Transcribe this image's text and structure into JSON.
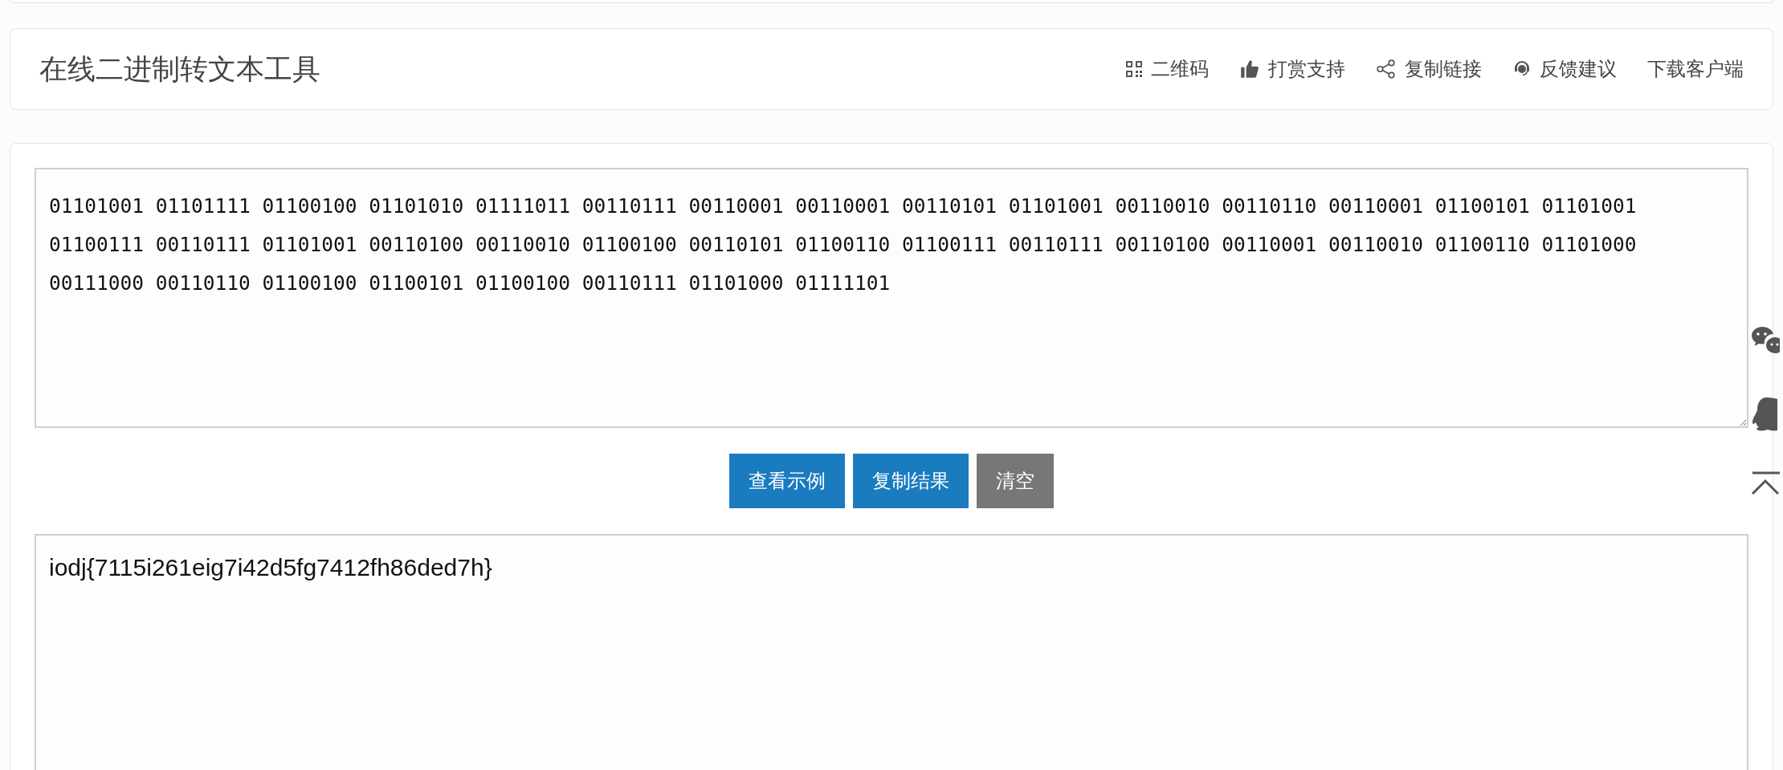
{
  "header": {
    "title": "在线二进制转文本工具",
    "nav": [
      {
        "kind": "qrcode",
        "label": "二维码"
      },
      {
        "kind": "thumb",
        "label": "打赏支持"
      },
      {
        "kind": "share",
        "label": "复制链接"
      },
      {
        "kind": "headset",
        "label": "反馈建议"
      },
      {
        "kind": "plain",
        "label": "下载客户端"
      }
    ]
  },
  "input": {
    "value": "01101001 01101111 01100100 01101010 01111011 00110111 00110001 00110001 00110101 01101001 00110010 00110110 00110001 01100101 01101001 01100111 00110111 01101001 00110100 00110010 01100100 00110101 01100110 01100111 00110111 00110100 00110001 00110010 01100110 01101000 00111000 00110110 01100100 01100101 01100100 00110111 01101000 01111101"
  },
  "buttons": [
    {
      "kind": "primary",
      "label": "查看示例"
    },
    {
      "kind": "primary",
      "label": "复制结果"
    },
    {
      "kind": "secondary",
      "label": "清空"
    }
  ],
  "output": {
    "value": "iodj{7115i261eig7i42d5fg7412fh86ded7h}"
  },
  "side_tools": [
    {
      "kind": "wechat"
    },
    {
      "kind": "qq"
    },
    {
      "kind": "top"
    }
  ]
}
